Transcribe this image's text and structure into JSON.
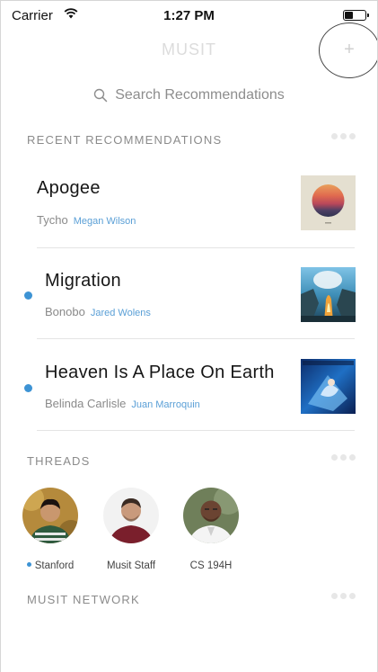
{
  "status_bar": {
    "carrier": "Carrier",
    "time": "1:27 PM"
  },
  "nav": {
    "app_title": "MUSIT",
    "add_label": "+"
  },
  "search": {
    "placeholder": "Search Recommendations"
  },
  "sections": {
    "recent": "RECENT RECOMMENDATIONS",
    "threads": "THREADS",
    "network": "MUSIT NETWORK"
  },
  "recommendations": [
    {
      "title": "Apogee",
      "artist": "Tycho",
      "recommended_by": "Megan Wilson",
      "unread": false
    },
    {
      "title": "Migration",
      "artist": "Bonobo",
      "recommended_by": "Jared Wolens",
      "unread": true
    },
    {
      "title": "Heaven Is A Place On Earth",
      "artist": "Belinda Carlisle",
      "recommended_by": "Juan Marroquin",
      "unread": true
    }
  ],
  "threads": [
    {
      "name": "Stanford",
      "unread": true
    },
    {
      "name": "Musit Staff",
      "unread": false
    },
    {
      "name": "CS 194H",
      "unread": false
    }
  ],
  "colors": {
    "accent": "#3d93d4",
    "link": "#5a9fd6",
    "muted_title": "#dcdcdc",
    "section_text": "#8b8b8b"
  },
  "icons": {
    "search": "magnifier-icon",
    "more": "ellipsis-icon",
    "add": "plus-icon"
  }
}
